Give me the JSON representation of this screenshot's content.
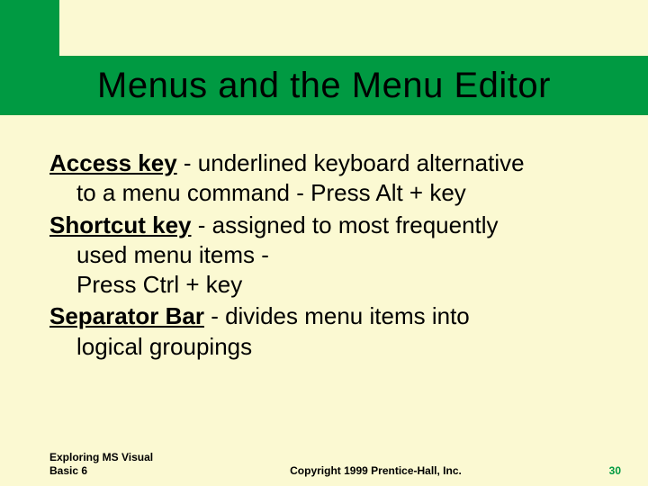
{
  "slide": {
    "title": "Menus and the Menu Editor"
  },
  "defs": [
    {
      "term": "Access key",
      "line1_rest": " - underlined keyboard alternative",
      "cont": [
        "to a menu command - Press Alt + key"
      ]
    },
    {
      "term": "Shortcut key",
      "line1_rest": " - assigned to most frequently",
      "cont": [
        "used menu items -",
        "Press Ctrl + key"
      ]
    },
    {
      "term": "Separator Bar",
      "line1_rest": " - divides menu items into",
      "cont": [
        "logical groupings"
      ]
    }
  ],
  "footer": {
    "left_line1": "Exploring MS Visual",
    "left_line2": "Basic 6",
    "center": "Copyright 1999 Prentice-Hall, Inc.",
    "page": "30"
  }
}
